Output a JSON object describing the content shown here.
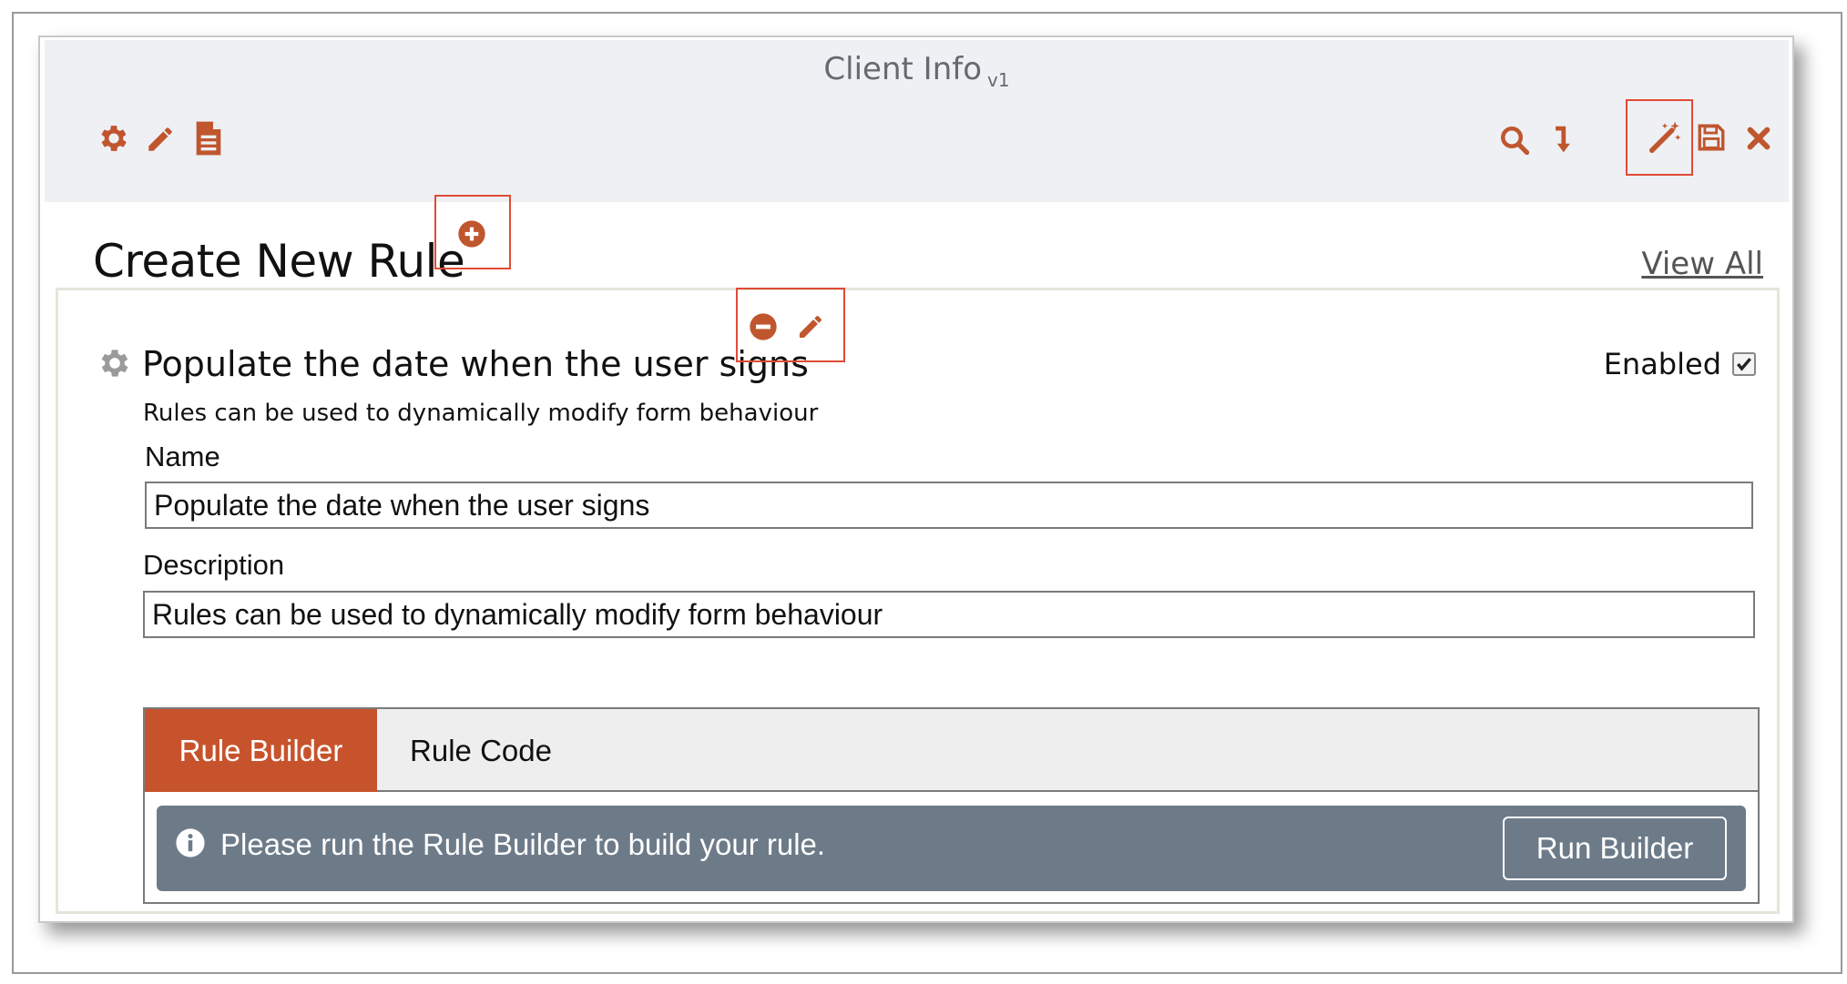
{
  "window": {
    "title": "Client Info",
    "version": "v1"
  },
  "toolbar": {
    "left_icons": [
      "gear-icon",
      "pencil-icon",
      "document-icon"
    ],
    "right_icons": [
      "search-icon",
      "arrow-down-icon",
      "magic-wand-icon",
      "save-icon",
      "close-icon"
    ],
    "icon_color": "#c0562e"
  },
  "page": {
    "heading": "Create New Rule",
    "view_all": "View All"
  },
  "rule": {
    "title": "Populate the date when the user signs",
    "subtitle": "Rules can be used to dynamically modify form behaviour",
    "enabled_label": "Enabled",
    "enabled": true,
    "name_label": "Name",
    "name_value": "Populate the date when the user signs",
    "description_label": "Description",
    "description_value": "Rules can be used to dynamically modify form behaviour"
  },
  "tabs": [
    {
      "label": "Rule Builder",
      "active": true
    },
    {
      "label": "Rule Code",
      "active": false
    }
  ],
  "info": {
    "message": "Please run the Rule Builder to build your rule.",
    "button_label": "Run Builder"
  },
  "colors": {
    "accent": "#c7532d",
    "highlight_box": "#e04a35",
    "info_bar": "#6d7b89",
    "header_bg": "#eef0f4"
  }
}
